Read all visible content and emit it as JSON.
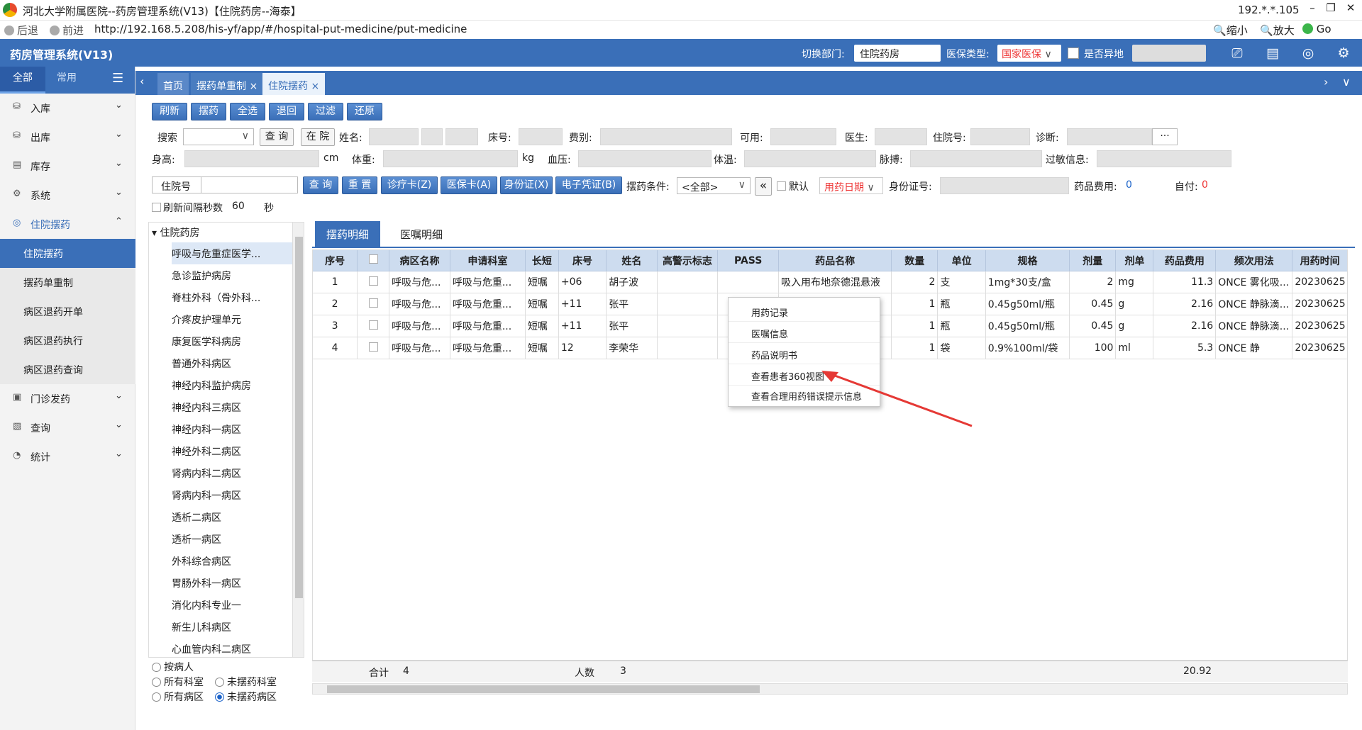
{
  "window": {
    "title": "河北大学附属医院--药房管理系统(V13)【住院药房--海泰】",
    "ip": "192.*.*.105",
    "buttons": {
      "min": "–",
      "max": "❐",
      "close": "✕"
    }
  },
  "browser": {
    "back": "后退",
    "forward": "前进",
    "url": "http://192.168.5.208/his-yf/app/#/hospital-put-medicine/put-medicine",
    "zoom_out": "缩小",
    "zoom_in": "放大",
    "go": "Go"
  },
  "header": {
    "brand": "药房管理系统(V13)",
    "dept_label": "切换部门:",
    "dept_value": "住院药房",
    "ins_label": "医保类型:",
    "ins_value": "国家医保",
    "remote_label": "是否异地"
  },
  "sidebar": {
    "tab_all": "全部",
    "tab_common": "常用",
    "menus": [
      {
        "label": "入库",
        "icon": "import-icon"
      },
      {
        "label": "出库",
        "icon": "export-icon"
      },
      {
        "label": "库存",
        "icon": "inventory-icon"
      },
      {
        "label": "系统",
        "icon": "gear-icon"
      },
      {
        "label": "住院摆药",
        "icon": "dispense-icon"
      }
    ],
    "subs": [
      "住院摆药",
      "摆药单重制",
      "病区退药开单",
      "病区退药执行",
      "病区退药查询"
    ],
    "menus2": [
      {
        "label": "门诊发药",
        "icon": "outpatient-icon"
      },
      {
        "label": "查询",
        "icon": "query-icon"
      },
      {
        "label": "统计",
        "icon": "stats-icon"
      }
    ]
  },
  "tabs": [
    {
      "label": "首页"
    },
    {
      "label": "摆药单重制",
      "close": "×"
    },
    {
      "label": "住院摆药",
      "close": "×"
    }
  ],
  "toolbar": [
    "刷新",
    "摆药",
    "全选",
    "退回",
    "过滤",
    "还原"
  ],
  "form": {
    "search_label": "搜索",
    "query": "查 询",
    "inhos": "在 院",
    "name": "姓名:",
    "bed": "床号:",
    "fee_type": "费别:",
    "usable": "可用:",
    "doctor": "医生:",
    "admission": "住院号:",
    "diagnosis": "诊断:",
    "dots": "···",
    "height": "身高:",
    "cm": "cm",
    "weight": "体重:",
    "kg": "kg",
    "bp": "血压:",
    "temp": "体温:",
    "pulse": "脉搏:",
    "allergy": "过敏信息:"
  },
  "search_bar": {
    "field": "住院号",
    "query": "查 询",
    "reset": "重 置",
    "card": "诊疗卡(Z)",
    "insurance": "医保卡(A)",
    "idcard": "身份证(X)",
    "ecert": "电子凭证(B)",
    "cond_label": "摆药条件:",
    "cond_value": "<全部>",
    "default": "默认",
    "date_sel": "用药日期",
    "idno": "身份证号:",
    "fee_label": "药品费用:",
    "fee_value": "0",
    "self_label": "自付:",
    "self_value": "0",
    "refresh_label": "刷新间隔秒数",
    "refresh_value": "60",
    "sec": "秒"
  },
  "ward": {
    "root": "住院药房",
    "items": [
      "呼吸与危重症医学...",
      "急诊监护病房",
      "脊柱外科（骨外科...",
      "介疼皮护理单元",
      "康复医学科病房",
      "普通外科病区",
      "神经内科监护病房",
      "神经内科三病区",
      "神经内科一病区",
      "神经外科二病区",
      "肾病内科二病区",
      "肾病内科一病区",
      "透析二病区",
      "透析一病区",
      "外科综合病区",
      "胃肠外科一病区",
      "消化内科专业一",
      "新生儿科病区",
      "心血管内科二病区"
    ],
    "by_patient": "按病人",
    "all_dept": "所有科室",
    "unput_dept": "未摆药科室",
    "all_ward": "所有病区",
    "unput_ward": "未摆药病区"
  },
  "detail_tabs": [
    "摆药明细",
    "医嘱明细"
  ],
  "table": {
    "headers": [
      "序号",
      "",
      "病区名称",
      "申请科室",
      "长短",
      "床号",
      "姓名",
      "高警示标志",
      "PASS",
      "药品名称",
      "数量",
      "单位",
      "规格",
      "剂量",
      "剂单",
      "药品费用",
      "频次用法",
      "用药时间"
    ],
    "rows": [
      [
        "1",
        "",
        "呼吸与危...",
        "呼吸与危重...",
        "短嘱",
        "+06",
        "胡子波",
        "",
        "",
        "吸入用布地奈德混悬液",
        "2",
        "支",
        "1mg*30支/盒",
        "2",
        "mg",
        "11.3",
        "ONCE 雾化吸...",
        "20230625"
      ],
      [
        "2",
        "",
        "呼吸与危...",
        "呼吸与危重...",
        "短嘱",
        "+11",
        "张平",
        "",
        "",
        "",
        "1",
        "瓶",
        "0.45g50ml/瓶",
        "0.45",
        "g",
        "2.16",
        "ONCE 静脉滴...",
        "20230625"
      ],
      [
        "3",
        "",
        "呼吸与危...",
        "呼吸与危重...",
        "短嘱",
        "+11",
        "张平",
        "",
        "",
        "",
        "1",
        "瓶",
        "0.45g50ml/瓶",
        "0.45",
        "g",
        "2.16",
        "ONCE 静脉滴...",
        "20230625"
      ],
      [
        "4",
        "",
        "呼吸与危...",
        "呼吸与危重...",
        "短嘱",
        "12",
        "李荣华",
        "",
        "",
        "",
        "1",
        "袋",
        "0.9%100ml/袋",
        "100",
        "ml",
        "5.3",
        "ONCE 静",
        "20230625"
      ]
    ]
  },
  "summary": {
    "total_label": "合计",
    "total_value": "4",
    "people_label": "人数",
    "people_value": "3",
    "fee": "20.92"
  },
  "context_menu": [
    "用药记录",
    "医嘱信息",
    "药品说明书",
    "查看患者360视图",
    "查看合理用药错误提示信息"
  ],
  "colors": {
    "accent": "#3a6fb8",
    "arrow": "#e53935",
    "red": "#e33333"
  }
}
